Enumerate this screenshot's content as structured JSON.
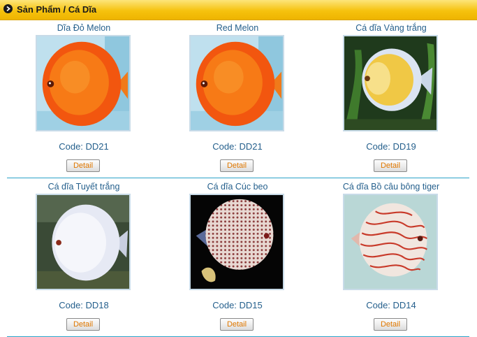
{
  "header": {
    "title": "Sản Phẩm / Cá Dĩa"
  },
  "products": [
    {
      "name": "Dĩa Đỏ Melon",
      "code": "Code: DD21",
      "button": "Detail",
      "image": "red-melon-discus"
    },
    {
      "name": "Red Melon",
      "code": "Code: DD21",
      "button": "Detail",
      "image": "red-melon-discus"
    },
    {
      "name": "Cá dĩa Vàng trắng",
      "code": "Code: DD19",
      "button": "Detail",
      "image": "yellow-white-discus"
    },
    {
      "name": "Cá dĩa Tuyết trắng",
      "code": "Code: DD18",
      "button": "Detail",
      "image": "snow-white-discus"
    },
    {
      "name": "Cá dĩa Cúc beo",
      "code": "Code: DD15",
      "button": "Detail",
      "image": "leopard-discus"
    },
    {
      "name": "Cá dĩa Bồ câu bông tiger",
      "code": "Code: DD14",
      "button": "Detail",
      "image": "pigeon-tiger-discus"
    }
  ],
  "colors": {
    "header_gold": "#f6c20e",
    "link_blue": "#245f8c",
    "button_text": "#e07800",
    "divider": "#2aa3c8"
  }
}
